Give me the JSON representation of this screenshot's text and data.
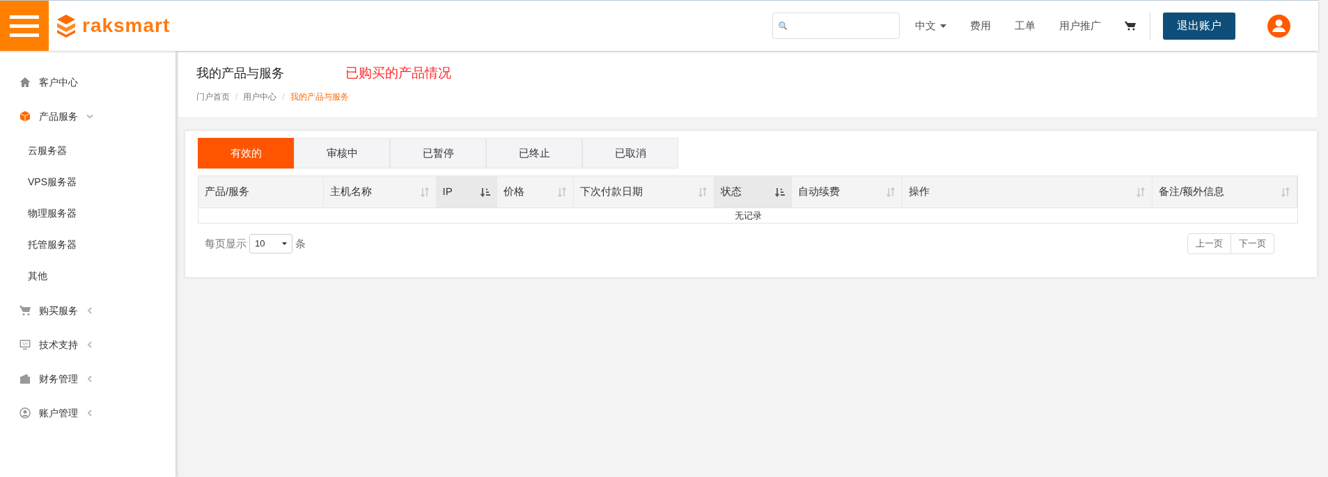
{
  "header": {
    "logo": "raksmart",
    "nav": [
      {
        "label": "中文",
        "dropdown": true
      },
      {
        "label": "费用",
        "dropdown": false
      },
      {
        "label": "工单",
        "dropdown": false
      },
      {
        "label": "用户推广",
        "dropdown": false
      }
    ],
    "logout": "退出账户"
  },
  "sidebar": {
    "items": [
      {
        "label": "客户中心",
        "kind": "link"
      },
      {
        "label": "产品服务",
        "kind": "group",
        "expanded": true,
        "children": [
          {
            "label": "云服务器"
          },
          {
            "label": "VPS服务器"
          },
          {
            "label": "物理服务器"
          },
          {
            "label": "托管服务器"
          },
          {
            "label": "其他"
          }
        ]
      },
      {
        "label": "购买服务",
        "kind": "group",
        "expanded": false
      },
      {
        "label": "技术支持",
        "kind": "group",
        "expanded": false
      },
      {
        "label": "财务管理",
        "kind": "group",
        "expanded": false
      },
      {
        "label": "账户管理",
        "kind": "group",
        "expanded": false
      }
    ]
  },
  "page": {
    "title": "我的产品与服务",
    "note": "已购买的产品情况",
    "breadcrumb_separator": "/",
    "breadcrumb": [
      {
        "label": "门户首页",
        "current": false
      },
      {
        "label": "用户中心",
        "current": false
      },
      {
        "label": "我的产品与服务",
        "current": true
      }
    ]
  },
  "tabs": [
    {
      "label": "有效的",
      "selected": true
    },
    {
      "label": "审核中",
      "selected": false
    },
    {
      "label": "已暂停",
      "selected": false
    },
    {
      "label": "已终止",
      "selected": false
    },
    {
      "label": "已取消",
      "selected": false
    }
  ],
  "table": {
    "columns": [
      {
        "label": "产品/服务"
      },
      {
        "label": "主机名称",
        "sortable": true,
        "sorted": false
      },
      {
        "label": "IP",
        "sortable": true,
        "sorted": true
      },
      {
        "label": "价格",
        "sortable": true,
        "sorted": false
      },
      {
        "label": "下次付款日期",
        "sortable": true,
        "sorted": false
      },
      {
        "label": "状态",
        "sortable": true,
        "sorted": true
      },
      {
        "label": "自动续费",
        "sortable": true,
        "sorted": false
      },
      {
        "label": "操作",
        "sortable": true,
        "sorted": false
      },
      {
        "label": "备注/额外信息",
        "sortable": true,
        "sorted": false
      }
    ],
    "empty": "无记录"
  },
  "pagination": {
    "per_page_label": "每页显示",
    "per_page": "10",
    "unit": "条",
    "prev": "上一页",
    "next": "下一页"
  }
}
